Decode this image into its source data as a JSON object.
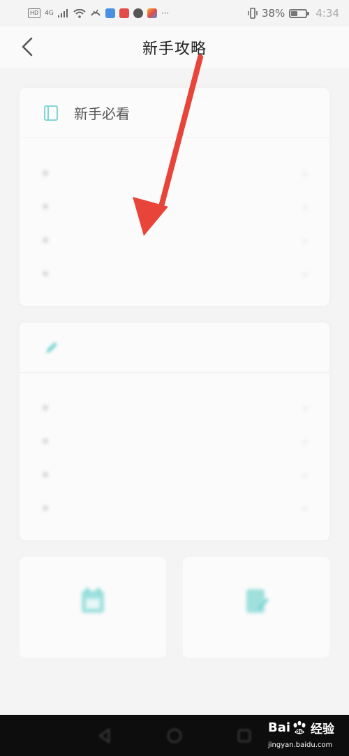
{
  "status_bar": {
    "chip_hd": "HD",
    "network": "4G",
    "battery_pct": "38%",
    "time": "4:34",
    "app_colors": [
      "#4a90e2",
      "#e34b4b",
      "#7b5bd6",
      "#f3b12c"
    ],
    "icons": [
      "signal-icon",
      "wifi-icon",
      "call-icon",
      "vibrate-icon",
      "battery-icon"
    ]
  },
  "header": {
    "title": "新手攻略",
    "back_icon": "chevron-left-icon"
  },
  "card_beginner": {
    "title": "新手必看",
    "icon": "book-icon",
    "icon_color": "#7fd6d3",
    "items": [
      "",
      "",
      "",
      ""
    ]
  },
  "card_guide": {
    "title": "",
    "icon": "pen-icon",
    "icon_color": "#7fd6d3",
    "items": [
      "",
      "",
      "",
      ""
    ]
  },
  "tiles": [
    {
      "label": "",
      "icon": "calendar-icon",
      "color": "#7fd6d3"
    },
    {
      "label": "",
      "icon": "edit-icon",
      "color": "#7fd6d3"
    }
  ],
  "nav_bar": {
    "icons": [
      "back-triangle-icon",
      "home-circle-icon",
      "recent-square-icon"
    ]
  },
  "watermark": {
    "url": "jingyan.baidu.com"
  },
  "annotation": {
    "arrow_color": "#e8443a"
  }
}
